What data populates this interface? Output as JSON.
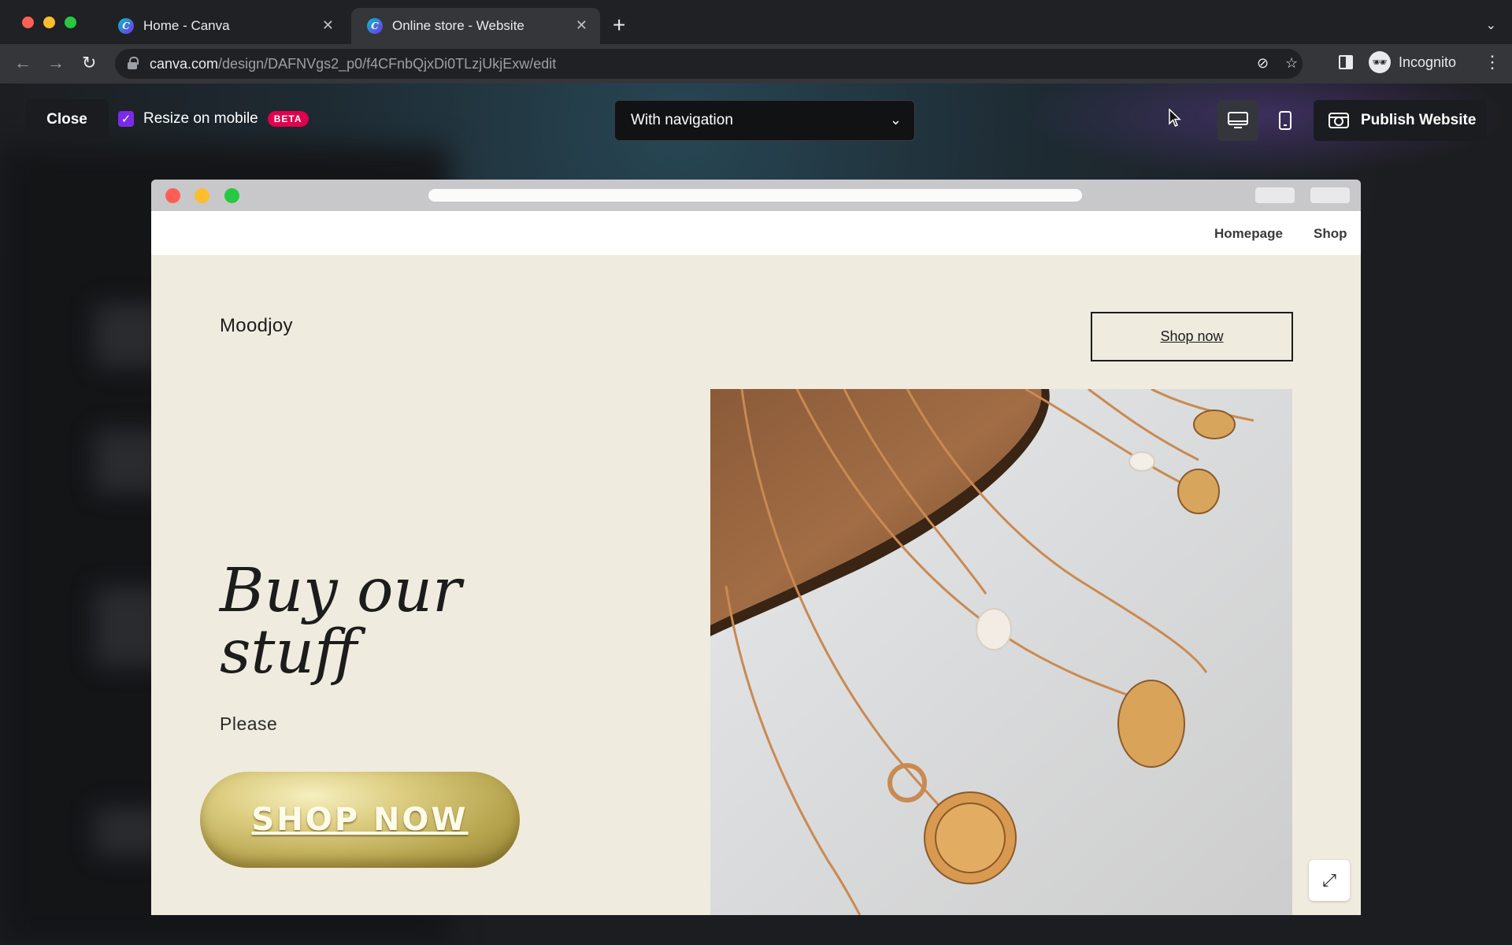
{
  "browser": {
    "tabs": [
      {
        "title": "Home - Canva",
        "favicon": "C"
      },
      {
        "title": "Online store - Website",
        "favicon": "C"
      }
    ],
    "new_tab": "+",
    "tab_menu": "⌄",
    "nav": {
      "back": "←",
      "forward": "→",
      "reload": "↻"
    },
    "url_host": "canva.com",
    "url_path": "/design/DAFNVgs2_p0/f4CFnbQjxDi0TLzjUkjExw/edit",
    "eye_off": "⊘",
    "star": "☆",
    "incognito_label": "Incognito",
    "incognito_avatar": "🕶",
    "kebab": "⋮"
  },
  "editor": {
    "close_label": "Close",
    "resize_checked": "✓",
    "resize_label": "Resize on mobile",
    "beta_badge": "BETA",
    "navigation_select": "With navigation",
    "navigation_chevron": "⌄",
    "publish_label": "Publish Website"
  },
  "site": {
    "nav": {
      "homepage": "Homepage",
      "shop": "Shop"
    },
    "brand": "Moodjoy",
    "header_cta": "Shop now",
    "headline": "Buy our stuff",
    "subtext": "Please",
    "hero_button": "SHOP NOW",
    "expand": "⤢"
  },
  "colors": {
    "accent_purple": "#7d2ae8",
    "beta_red": "#e0004d",
    "site_background": "#efebde",
    "button_gold": "#c9b869"
  }
}
